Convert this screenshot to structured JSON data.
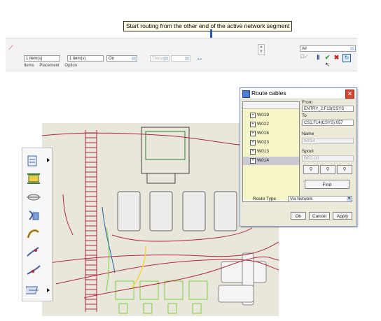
{
  "tooltip": {
    "text": "Start routing from the other end of the active network segment"
  },
  "dashboard": {
    "field1": "1 item(s)",
    "field2": "1 item(s)",
    "on_select": "On",
    "through_select": "Through",
    "spin": "",
    "filter": "All",
    "tabs": [
      "Items",
      "Placement",
      "Option"
    ]
  },
  "dialog": {
    "title": "Route cables",
    "cables": [
      "W019",
      "W022",
      "W016",
      "W023",
      "W013",
      "W014"
    ],
    "selected_cable": "W014",
    "from_label": "From",
    "from_value": "ENTRY_2:F13(CSYS",
    "to_label": "To",
    "to_value": "CS1:F14(CSYS):057",
    "name_label": "Name",
    "name_value": "W014",
    "spool_label": "Spool",
    "spool_value": "REC-20",
    "find_label": "Find",
    "route_type_label": "Route Type",
    "route_type_value": "Via Network",
    "ok_label": "Ok",
    "cancel_label": "Cancel",
    "apply_label": "Apply"
  },
  "colors": {
    "canvas_bg": "#e9e6dc",
    "wire_red": "#b1273b",
    "accent_blue": "#1f5fa8",
    "green": "#7ad13a",
    "yellow": "#f2d93b"
  },
  "icons": {
    "dashboard": [
      "route-icon",
      "paste-icon",
      "pause-icon",
      "accept-icon",
      "cancel-icon",
      "reverse-route-icon"
    ],
    "left_toolbar": [
      "harness-icon",
      "cable-icon",
      "locate-icon",
      "reel-icon",
      "network-icon",
      "wire-end-icon",
      "branch-icon",
      "bundle-icon"
    ]
  }
}
